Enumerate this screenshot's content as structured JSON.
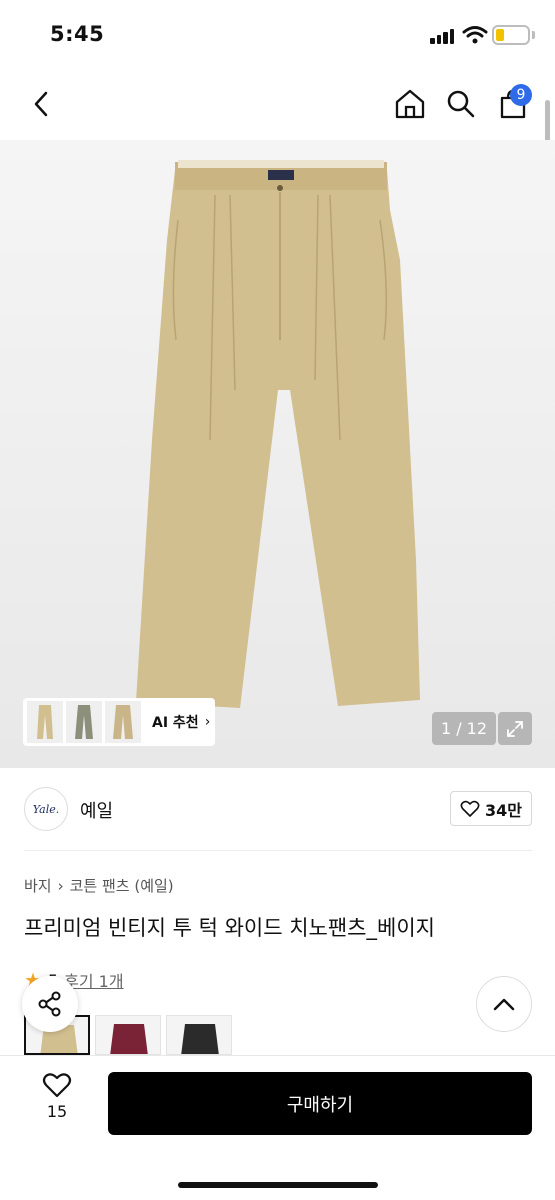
{
  "status_bar": {
    "time": "5:45"
  },
  "header": {
    "cart_badge": "9"
  },
  "gallery": {
    "counter": "1 / 12",
    "ai_label": "AI 추천",
    "product_color": "#d2bf8f"
  },
  "brand": {
    "logo_text": "Yale.",
    "name": "예일",
    "like_count": "34만"
  },
  "product": {
    "breadcrumb": [
      "바지",
      "코튼 팬츠 (예일)"
    ],
    "title": "프리미엄 빈티지 투 턱 와이드 치노팬츠_베이지",
    "rating": "5",
    "review_text": "후기 1개"
  },
  "colors": [
    "#d2bf8f",
    "#7a2337",
    "#2b2b2b"
  ],
  "bottom_bar": {
    "wish_count": "15",
    "buy_label": "구매하기"
  }
}
